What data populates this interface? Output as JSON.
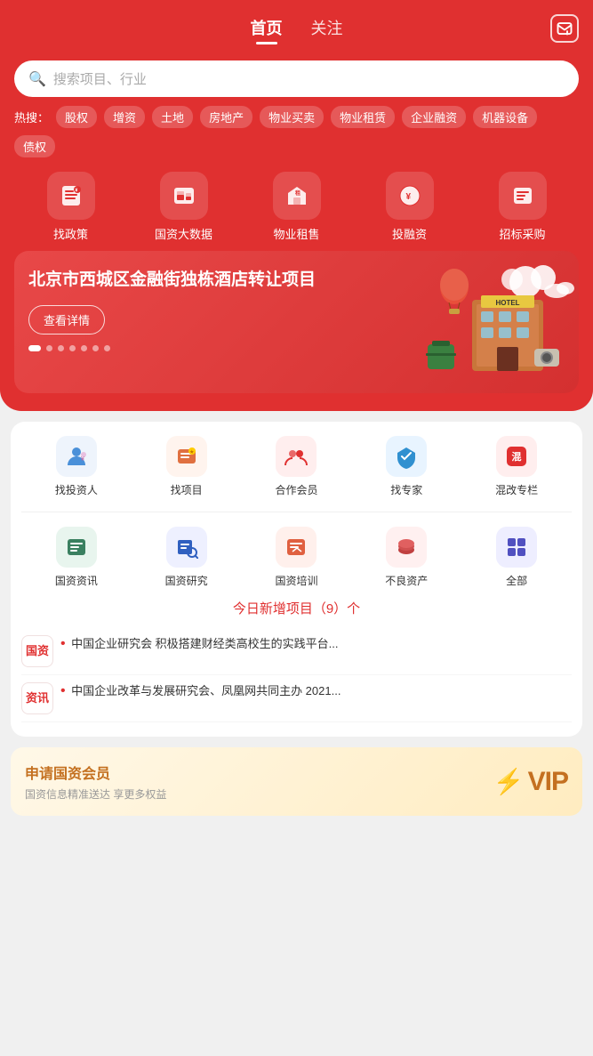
{
  "header": {
    "tab_home": "首页",
    "tab_follow": "关注",
    "msg_icon": "message"
  },
  "search": {
    "placeholder": "搜索项目、行业"
  },
  "hot_search": {
    "label": "热搜：",
    "tags": [
      "股权",
      "增资",
      "土地",
      "房地产",
      "物业买卖",
      "物业租赁",
      "企业融资",
      "机器设备",
      "债权"
    ]
  },
  "functions": [
    {
      "icon": "📋",
      "label": "找政策"
    },
    {
      "icon": "🏛",
      "label": "国资大数据"
    },
    {
      "icon": "🏠",
      "label": "物业租售"
    },
    {
      "icon": "💰",
      "label": "投融资"
    },
    {
      "icon": "📦",
      "label": "招标采购"
    }
  ],
  "banner": {
    "title": "北京市西城区金融街独栋酒店转让项目",
    "button": "查看详情",
    "dots": [
      true,
      false,
      false,
      false,
      false,
      false,
      false
    ]
  },
  "services": [
    {
      "icon": "👤",
      "color": "#4a90d9",
      "label": "找投资人"
    },
    {
      "icon": "📁",
      "color": "#e07040",
      "label": "找项目"
    },
    {
      "icon": "🤝",
      "color": "#e03030",
      "label": "合作会员"
    },
    {
      "icon": "🎓",
      "color": "#3090d0",
      "label": "找专家"
    },
    {
      "icon": "🏷",
      "color": "#e03030",
      "label": "混改专栏"
    }
  ],
  "news_icons": [
    {
      "icon": "📰",
      "color": "#3a8060",
      "label": "国资资讯"
    },
    {
      "icon": "🔬",
      "color": "#3060c0",
      "label": "国资研究"
    },
    {
      "icon": "📚",
      "color": "#e06040",
      "label": "国资培训"
    },
    {
      "icon": "⚠",
      "color": "#c04040",
      "label": "不良资产"
    },
    {
      "icon": "⚙",
      "color": "#5050c0",
      "label": "全部"
    }
  ],
  "today_count": "今日新增项目（9）个",
  "news_items": [
    {
      "badge": [
        "国资",
        ""
      ],
      "bullet": "•",
      "text": "中国企业研究会 积极搭建财经类高校生的实践平台..."
    },
    {
      "badge": [
        "资讯",
        ""
      ],
      "bullet": "•",
      "text": "中国企业改革与发展研究会、凤凰网共同主办 2021..."
    }
  ],
  "vip": {
    "title": "申请国资会员",
    "subtitle": "国资信息精准送达 享更多权益",
    "badge": "VIP"
  }
}
